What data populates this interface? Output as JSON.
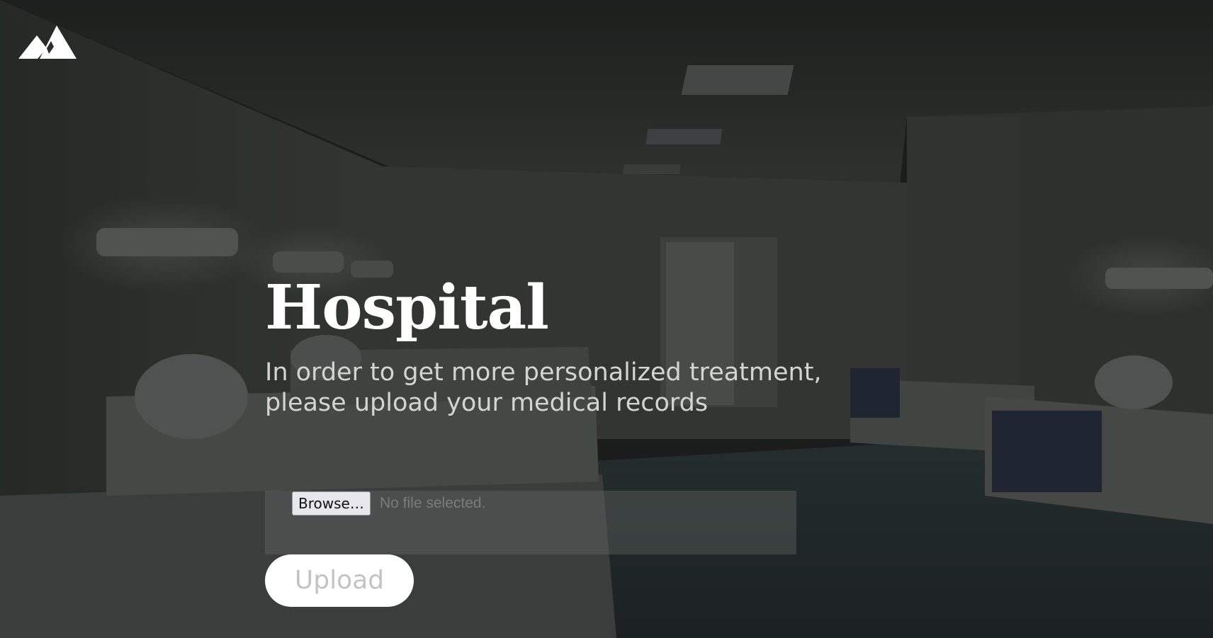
{
  "header": {
    "logo_icon": "mountain-logo-icon"
  },
  "hero": {
    "title": "Hospital",
    "subtitle_line1": "In order to get more personalized treatment,",
    "subtitle_line2": "please upload your medical records"
  },
  "upload_form": {
    "browse_label": "Browse…",
    "file_status": "No file selected.",
    "upload_label": "Upload"
  },
  "colors": {
    "title": "#ffffff",
    "subtitle": "#d4d4d2",
    "upload_button_bg": "#ffffff",
    "upload_button_text": "#c3c3c3",
    "overlay": "#2a2d2b"
  }
}
